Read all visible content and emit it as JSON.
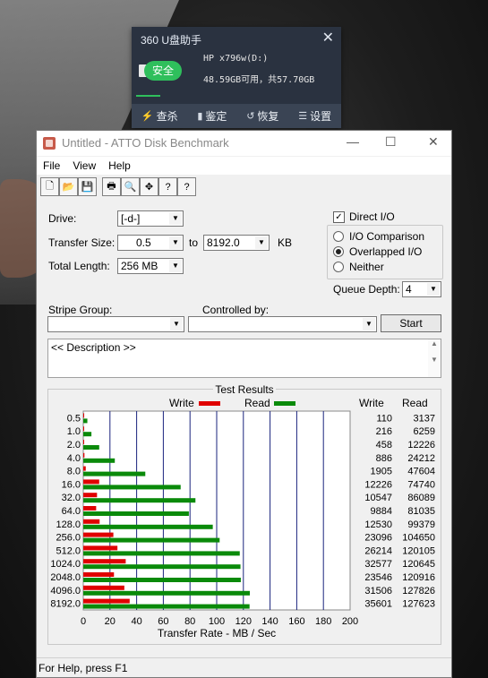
{
  "popup": {
    "title": "360 U盘助手",
    "close": "✕",
    "badge": "安全",
    "device": "HP x796w(D:)",
    "space": "48.59GB可用，共57.70GB",
    "tools": [
      {
        "icon": "⚡",
        "label": "查杀"
      },
      {
        "icon": "▮",
        "label": "鉴定"
      },
      {
        "icon": "↺",
        "label": "恢复"
      },
      {
        "icon": "☰",
        "label": "设置"
      }
    ]
  },
  "window": {
    "title": "Untitled - ATTO Disk Benchmark",
    "minimize": "—",
    "maximize": "☐",
    "close": "✕",
    "menus": [
      "File",
      "View",
      "Help"
    ],
    "toolbar": [
      "🗋",
      "📂",
      "💾",
      "🖶",
      "🔍",
      "✥",
      "?",
      "?"
    ]
  },
  "form": {
    "drive_label": "Drive:",
    "drive_value": "[-d-]",
    "transfer_label": "Transfer Size:",
    "transfer_from": "0.5",
    "transfer_to_label": "to",
    "transfer_to": "8192.0",
    "transfer_unit": "KB",
    "total_label": "Total Length:",
    "total_value": "256 MB",
    "direct_io": "Direct I/O",
    "io_comparison": "I/O Comparison",
    "overlapped_io": "Overlapped I/O",
    "neither": "Neither",
    "queue_label": "Queue Depth:",
    "queue_value": "4",
    "stripe_label": "Stripe Group:",
    "controlled_label": "Controlled by:",
    "start_label": "Start",
    "description": "<< Description >>"
  },
  "results": {
    "title": "Test Results",
    "legend_write": "Write",
    "legend_read": "Read",
    "col_write": "Write",
    "col_read": "Read",
    "write_color": "#e00000",
    "read_color": "#0a8a0a"
  },
  "chart_data": {
    "type": "bar",
    "orientation": "horizontal",
    "categories": [
      "0.5",
      "1.0",
      "2.0",
      "4.0",
      "8.0",
      "16.0",
      "32.0",
      "64.0",
      "128.0",
      "256.0",
      "512.0",
      "1024.0",
      "2048.0",
      "4096.0",
      "8192.0"
    ],
    "series": [
      {
        "name": "Write",
        "values": [
          0.11,
          0.21,
          0.45,
          0.87,
          1.86,
          11.94,
          10.3,
          9.65,
          12.24,
          22.55,
          25.6,
          31.81,
          23.0,
          30.77,
          34.77
        ]
      },
      {
        "name": "Read",
        "values": [
          3.06,
          6.11,
          11.94,
          23.64,
          46.49,
          72.99,
          84.07,
          79.14,
          97.07,
          102.2,
          117.29,
          117.82,
          118.08,
          124.83,
          124.63
        ]
      }
    ],
    "table_write": [
      "110",
      "216",
      "458",
      "886",
      "1905",
      "12226",
      "10547",
      "9884",
      "12530",
      "23096",
      "26214",
      "32577",
      "23546",
      "31506",
      "35601"
    ],
    "table_read": [
      "3137",
      "6259",
      "12226",
      "24212",
      "47604",
      "74740",
      "86089",
      "81035",
      "99379",
      "104650",
      "120105",
      "120645",
      "120916",
      "127826",
      "127623"
    ],
    "xlabel": "Transfer Rate - MB / Sec",
    "xlim": [
      0,
      200
    ],
    "xticks": [
      "0",
      "20",
      "40",
      "60",
      "80",
      "100",
      "120",
      "140",
      "160",
      "180",
      "200"
    ],
    "grid": true
  },
  "status": {
    "text": "For Help, press F1"
  }
}
